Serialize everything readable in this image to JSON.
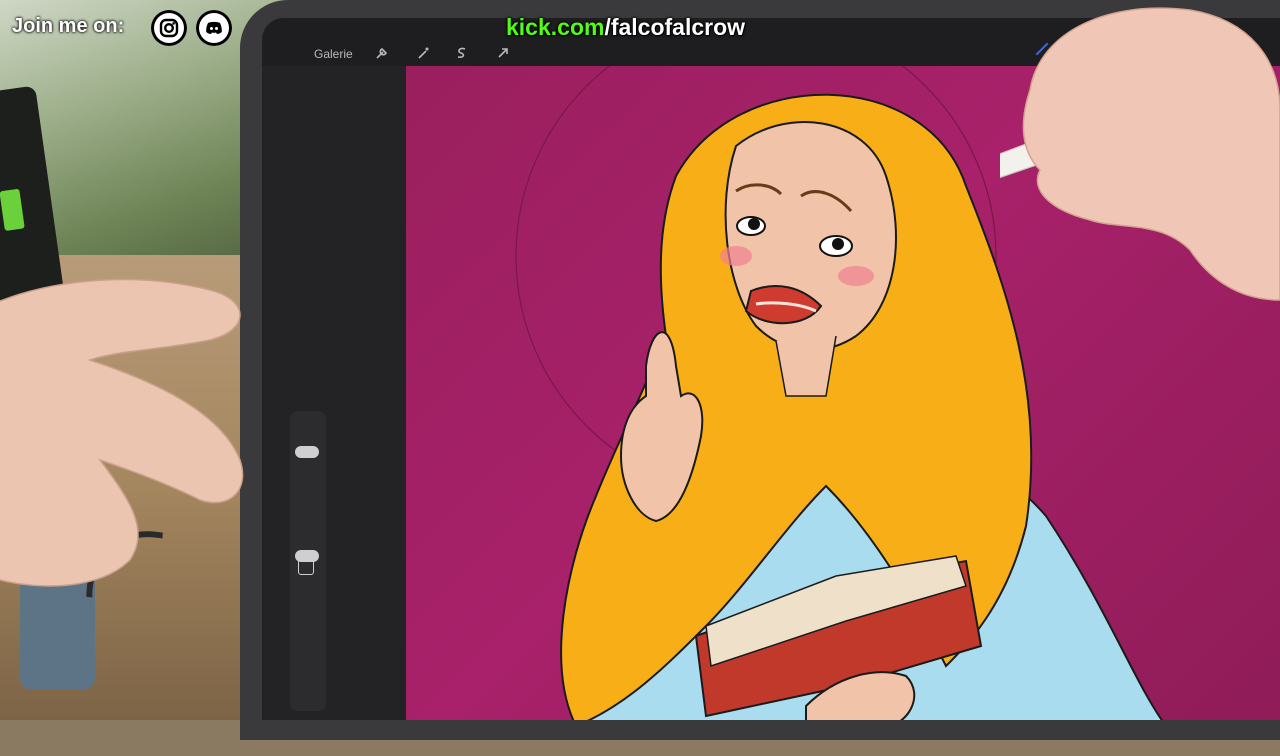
{
  "overlay": {
    "join_label": "Join me on:",
    "social_icons": [
      "instagram-icon",
      "discord-icon"
    ],
    "kick_domain": "kick.com",
    "kick_path": "/falcofalcrow",
    "kick_color": "#53fc18"
  },
  "app": {
    "gallery_label": "Galerie",
    "toolbar_icons": [
      "wrench-icon",
      "magic-wand-icon",
      "selection-icon",
      "transform-arrow-icon"
    ],
    "sidebar": {
      "modify_icon": "square-icon",
      "undo_icon": "undo-arrow-icon"
    },
    "canvas_background": "#a8216a",
    "active_brush_color": "#3b63ff"
  }
}
